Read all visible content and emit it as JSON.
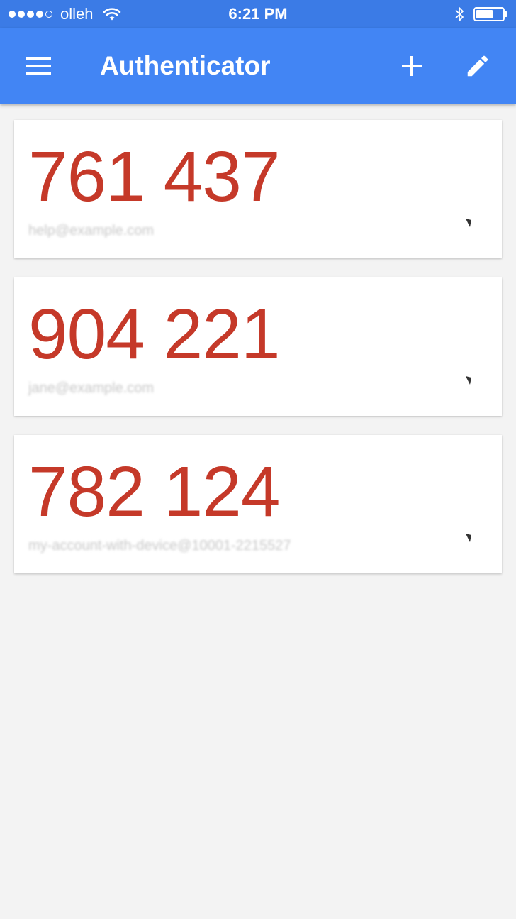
{
  "status_bar": {
    "carrier": "olleh",
    "time": "6:21 PM",
    "signal_bars_filled": 4,
    "signal_bars_total": 5,
    "battery_level": 0.65
  },
  "app_bar": {
    "title": "Authenticator",
    "background_color": "#4285f4",
    "icons": [
      "menu-icon",
      "add-icon",
      "edit-icon"
    ]
  },
  "accounts": [
    {
      "code": "761 437",
      "account": "help@example.com",
      "color": "#c53929"
    },
    {
      "code": "904 221",
      "account": "jane@example.com",
      "color": "#c53929"
    },
    {
      "code": "782 124",
      "account": "my-account-with-device@10001-2215527",
      "color": "#c53929"
    }
  ]
}
